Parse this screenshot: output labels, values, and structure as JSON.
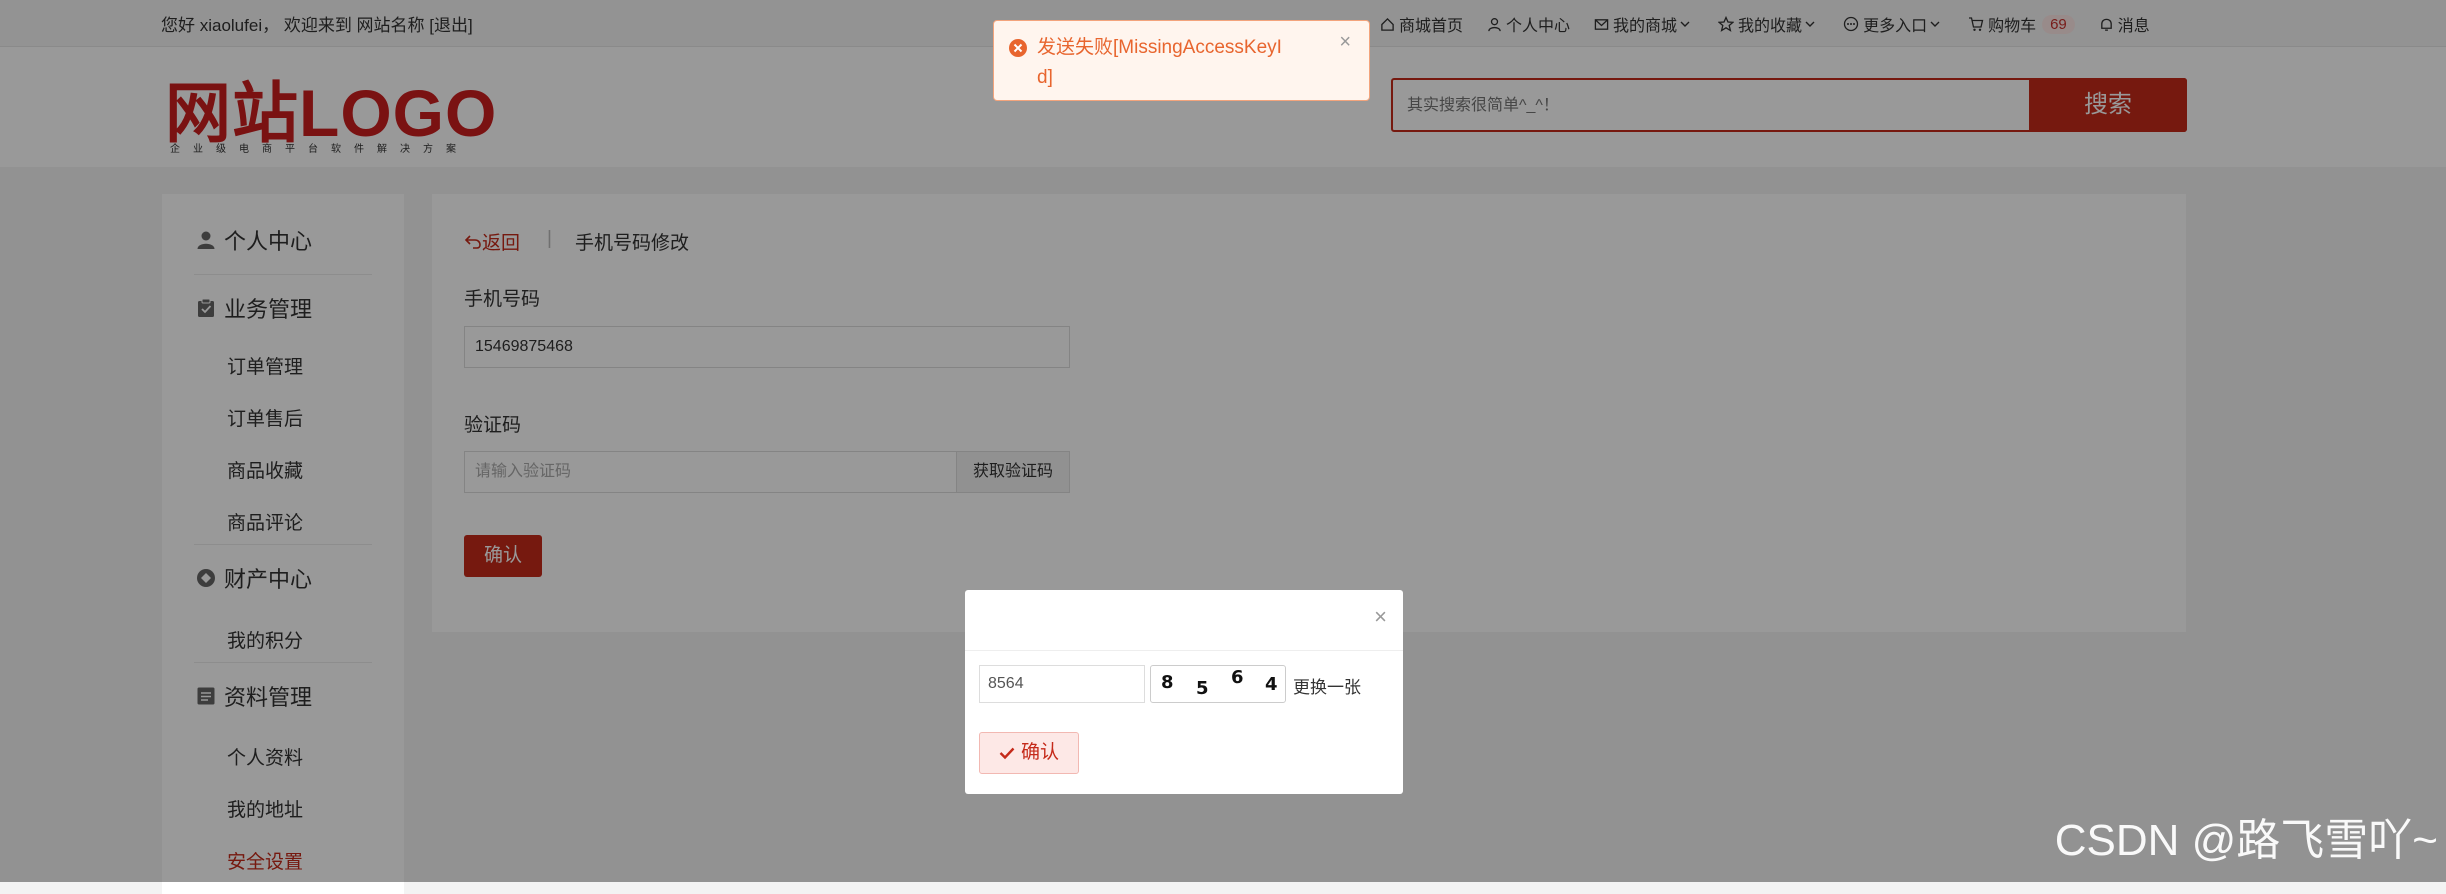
{
  "topbar": {
    "greeting": "您好 xiaolufei，  欢迎来到 网站名称 [退出]",
    "nav": [
      {
        "label": "商城首页",
        "icon": "home-icon"
      },
      {
        "label": "个人中心",
        "icon": "user-icon"
      },
      {
        "label": "我的商城",
        "icon": "mail-icon"
      },
      {
        "label": "我的收藏",
        "icon": "star-icon"
      },
      {
        "label": "更多入口",
        "icon": "more-icon"
      },
      {
        "label": "购物车",
        "icon": "cart-icon"
      },
      {
        "label": "消息",
        "icon": "bell-icon"
      }
    ],
    "cart_count": "69"
  },
  "header": {
    "logo_text": "网站LOGO",
    "slogan": "企业级电商平台软件解决方案",
    "search_placeholder": "其实搜索很简单^_^！",
    "search_button": "搜索"
  },
  "sidebar": {
    "sections": [
      {
        "title": "个人中心",
        "icon": "user-icon",
        "items": []
      },
      {
        "title": "业务管理",
        "icon": "clipboard-icon",
        "items": [
          "订单管理",
          "订单售后",
          "商品收藏",
          "商品评论"
        ]
      },
      {
        "title": "财产中心",
        "icon": "diamond-icon",
        "items": [
          "我的积分"
        ]
      },
      {
        "title": "资料管理",
        "icon": "profile-icon",
        "items": [
          "个人资料",
          "我的地址",
          "安全设置"
        ]
      }
    ],
    "active_item": "安全设置"
  },
  "main": {
    "back_label": "返回",
    "separator": "|",
    "breadcrumb": "手机号码修改",
    "phone_label": "手机号码",
    "phone_value": "15469875468",
    "code_label": "验证码",
    "code_placeholder": "请输入验证码",
    "get_code_button": "获取验证码",
    "confirm_button": "确认"
  },
  "modal": {
    "close": "×",
    "captcha_input_value": "8564",
    "captcha_digits": [
      "8",
      "5",
      "6",
      "4"
    ],
    "refresh_label": "更换一张",
    "confirm_button": "确认"
  },
  "toast": {
    "message": "发送失败[MissingAccessKeyId]",
    "close": "×"
  },
  "watermark": "CSDN @路飞雪吖~",
  "colors": {
    "brand": "#c52a1a",
    "toast_text": "#e8652e",
    "toast_bg": "#fff5ee"
  }
}
